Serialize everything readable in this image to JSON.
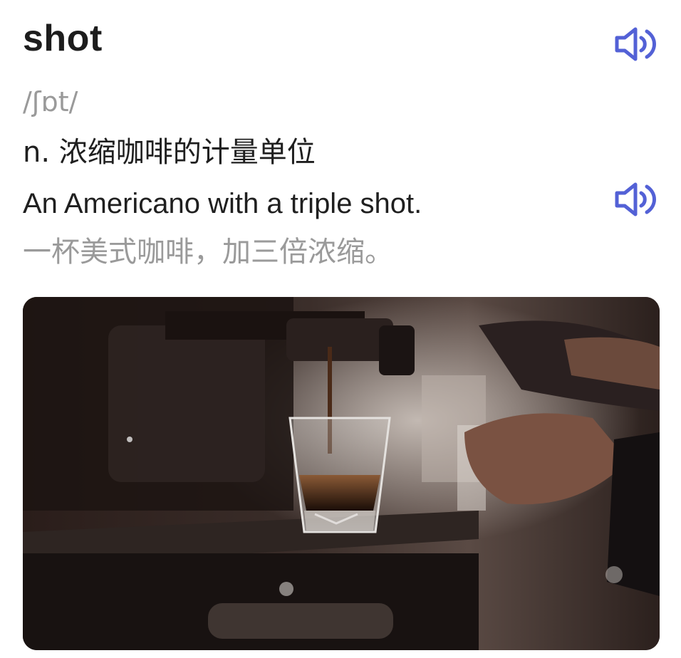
{
  "entry": {
    "word": "shot",
    "phonetic": "/ʃɒt/",
    "definition": "n. 浓缩咖啡的计量单位",
    "example": "An Americano with a triple shot.",
    "example_translation": "一杯美式咖啡，加三倍浓缩。"
  },
  "icons": {
    "audio": "speaker-icon"
  },
  "colors": {
    "accent": "#5361d6",
    "text": "#1f1f1f",
    "muted": "#9a9a9a"
  },
  "image": {
    "subject": "espresso-shot-photo"
  }
}
